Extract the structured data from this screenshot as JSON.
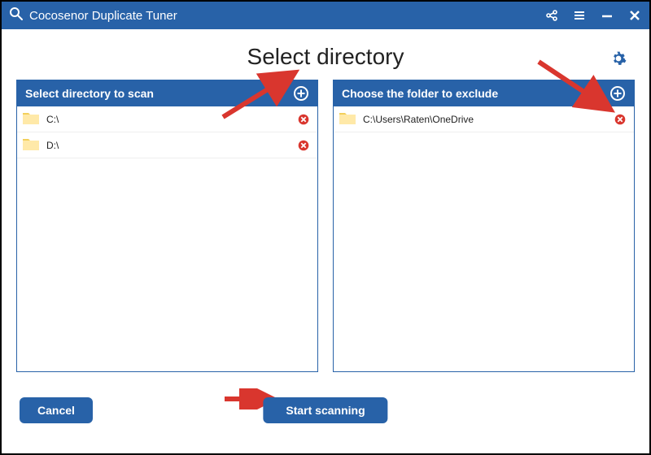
{
  "app": {
    "title": "Cocosenor Duplicate Tuner"
  },
  "page": {
    "title": "Select directory"
  },
  "scan_panel": {
    "header": "Select directory to scan",
    "items": [
      {
        "path": "C:\\"
      },
      {
        "path": "D:\\"
      }
    ]
  },
  "exclude_panel": {
    "header": "Choose the folder to exclude",
    "items": [
      {
        "path": "C:\\Users\\Raten\\OneDrive"
      }
    ]
  },
  "buttons": {
    "cancel": "Cancel",
    "start": "Start scanning"
  },
  "colors": {
    "primary": "#2862a8",
    "remove": "#d9362e",
    "arrow": "#d9362e",
    "folder_light": "#ffe9a8",
    "folder_dark": "#f3cf5b"
  }
}
